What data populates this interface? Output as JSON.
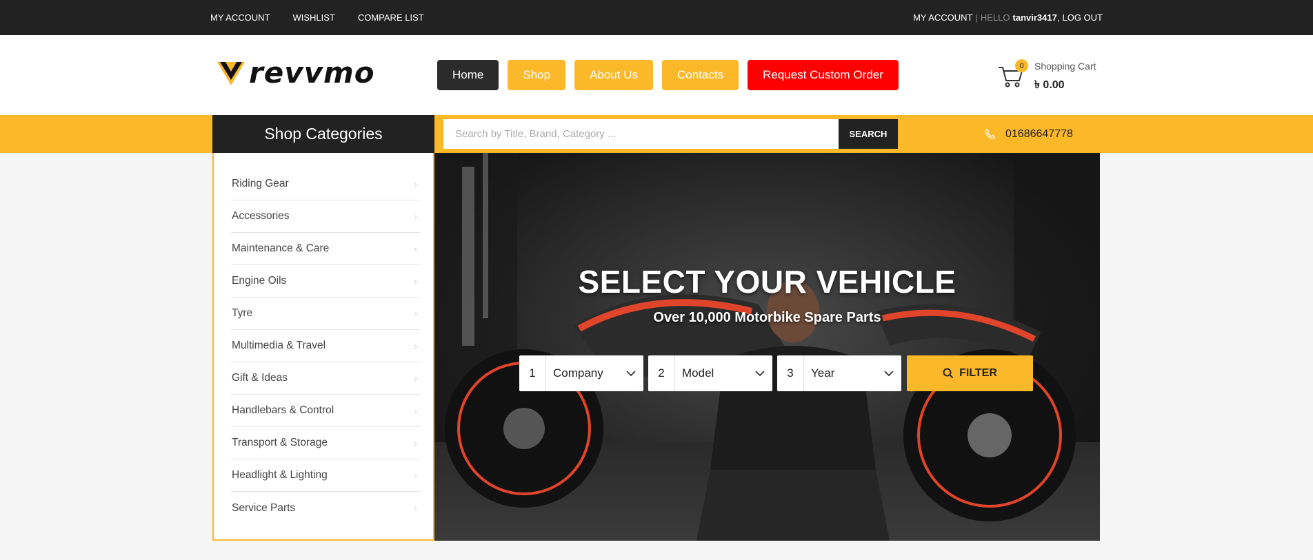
{
  "topbar": {
    "links": [
      "MY ACCOUNT",
      "WISHLIST",
      "COMPARE LIST"
    ],
    "account": "MY ACCOUNT",
    "separator": "|",
    "hello": "HELLO",
    "username": "tanvir3417",
    "comma": ",",
    "logout": "LOG OUT"
  },
  "brand": {
    "name": "revvmo"
  },
  "nav": {
    "home": "Home",
    "shop": "Shop",
    "about": "About Us",
    "contacts": "Contacts",
    "custom_order": "Request Custom Order"
  },
  "cart": {
    "count": "0",
    "label": "Shopping Cart",
    "total": "৳ 0.00",
    "icon": "cart-icon"
  },
  "categories": {
    "title": "Shop Categories",
    "items": [
      "Riding Gear",
      "Accessories",
      "Maintenance & Care",
      "Engine Oils",
      "Tyre",
      "Multimedia & Travel",
      "Gift & Ideas",
      "Handlebars & Control",
      "Transport & Storage",
      "Headlight & Lighting",
      "Service Parts"
    ]
  },
  "search": {
    "placeholder": "Search by Title, Brand, Category ...",
    "button": "SEARCH",
    "value": ""
  },
  "contact": {
    "phone": "01686647778",
    "icon": "phone-icon"
  },
  "hero": {
    "title": "SELECT YOUR VEHICLE",
    "subtitle": "Over 10,000 Motorbike Spare Parts",
    "filters": [
      {
        "num": "1",
        "label": "Company"
      },
      {
        "num": "2",
        "label": "Model"
      },
      {
        "num": "3",
        "label": "Year"
      }
    ],
    "filter_button": "FILTER"
  },
  "colors": {
    "accent": "#fbb829",
    "dark": "#222222",
    "red": "#ff0000"
  }
}
